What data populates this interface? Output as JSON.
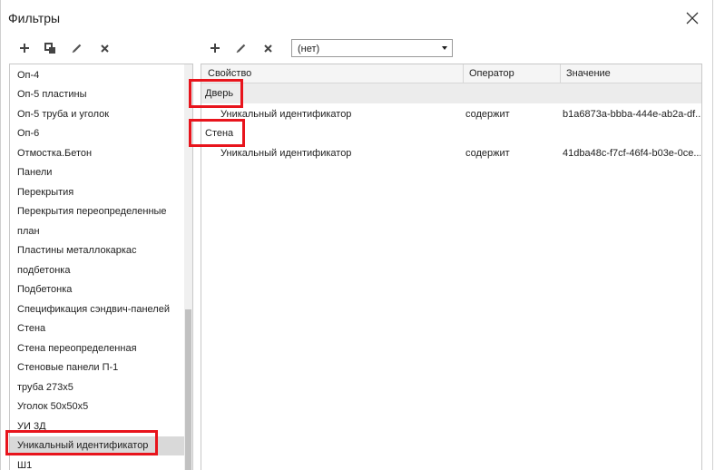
{
  "window": {
    "title": "Фильтры"
  },
  "left_toolbar": {
    "icons": [
      "plus-icon",
      "copy-icon",
      "pencil-icon",
      "delete-x-icon"
    ]
  },
  "right_toolbar": {
    "icons": [
      "plus-icon",
      "pencil-icon",
      "delete-x-icon"
    ],
    "select_value": "(нет)"
  },
  "filter_list": {
    "items": [
      "Оп-4",
      "Оп-5 пластины",
      "Оп-5 труба и уголок",
      "Оп-6",
      "Отмостка.Бетон",
      "Панели",
      "Перекрытия",
      "Перекрытия переопределенные",
      "план",
      "Пластины металлокаркас",
      "подбетонка",
      "Подбетонка",
      "Спецификация сэндвич-панелей",
      "Стена",
      "Стена переопределенная",
      "Стеновые панели П-1",
      "труба 273х5",
      "Уголок 50х50х5",
      "УИ 3Д",
      "Уникальный идентификатор",
      "Ш1"
    ],
    "selected": "Уникальный идентификатор"
  },
  "rules_table": {
    "columns": [
      "Свойство",
      "Оператор",
      "Значение"
    ],
    "groups": [
      {
        "name": "Дверь",
        "rows": [
          {
            "property": "Уникальный идентификатор",
            "operator": "содержит",
            "value": "b1a6873a-bbba-444e-ab2a-df..."
          }
        ]
      },
      {
        "name": "Стена",
        "rows": [
          {
            "property": "Уникальный идентификатор",
            "operator": "содержит",
            "value": "41dba48c-f7cf-46f4-b03e-0ce..."
          }
        ]
      }
    ]
  },
  "colors": {
    "highlight": "#e8141c",
    "selected_row": "#d9d9d9",
    "group_row": "#ececec"
  }
}
